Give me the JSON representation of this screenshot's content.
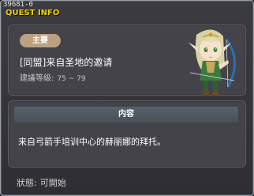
{
  "window": {
    "quest_id": "39681-0",
    "title": "QUEST INFO"
  },
  "quest": {
    "category_badge": "主要",
    "name": "[同盟]来自圣地的邀请",
    "level_label": "建議等級:",
    "level_range": "75 ~ 79"
  },
  "content": {
    "header": "内容",
    "description": "来自弓箭手培训中心的赫丽娜的拜托。"
  },
  "status": {
    "label": "狀態:",
    "value": "可開始"
  },
  "npc": {
    "icon": "archer-npc-portrait"
  },
  "colors": {
    "title_yellow": "#f2d200",
    "badge_tan": "#bba180",
    "panel_bg": "#434349"
  }
}
